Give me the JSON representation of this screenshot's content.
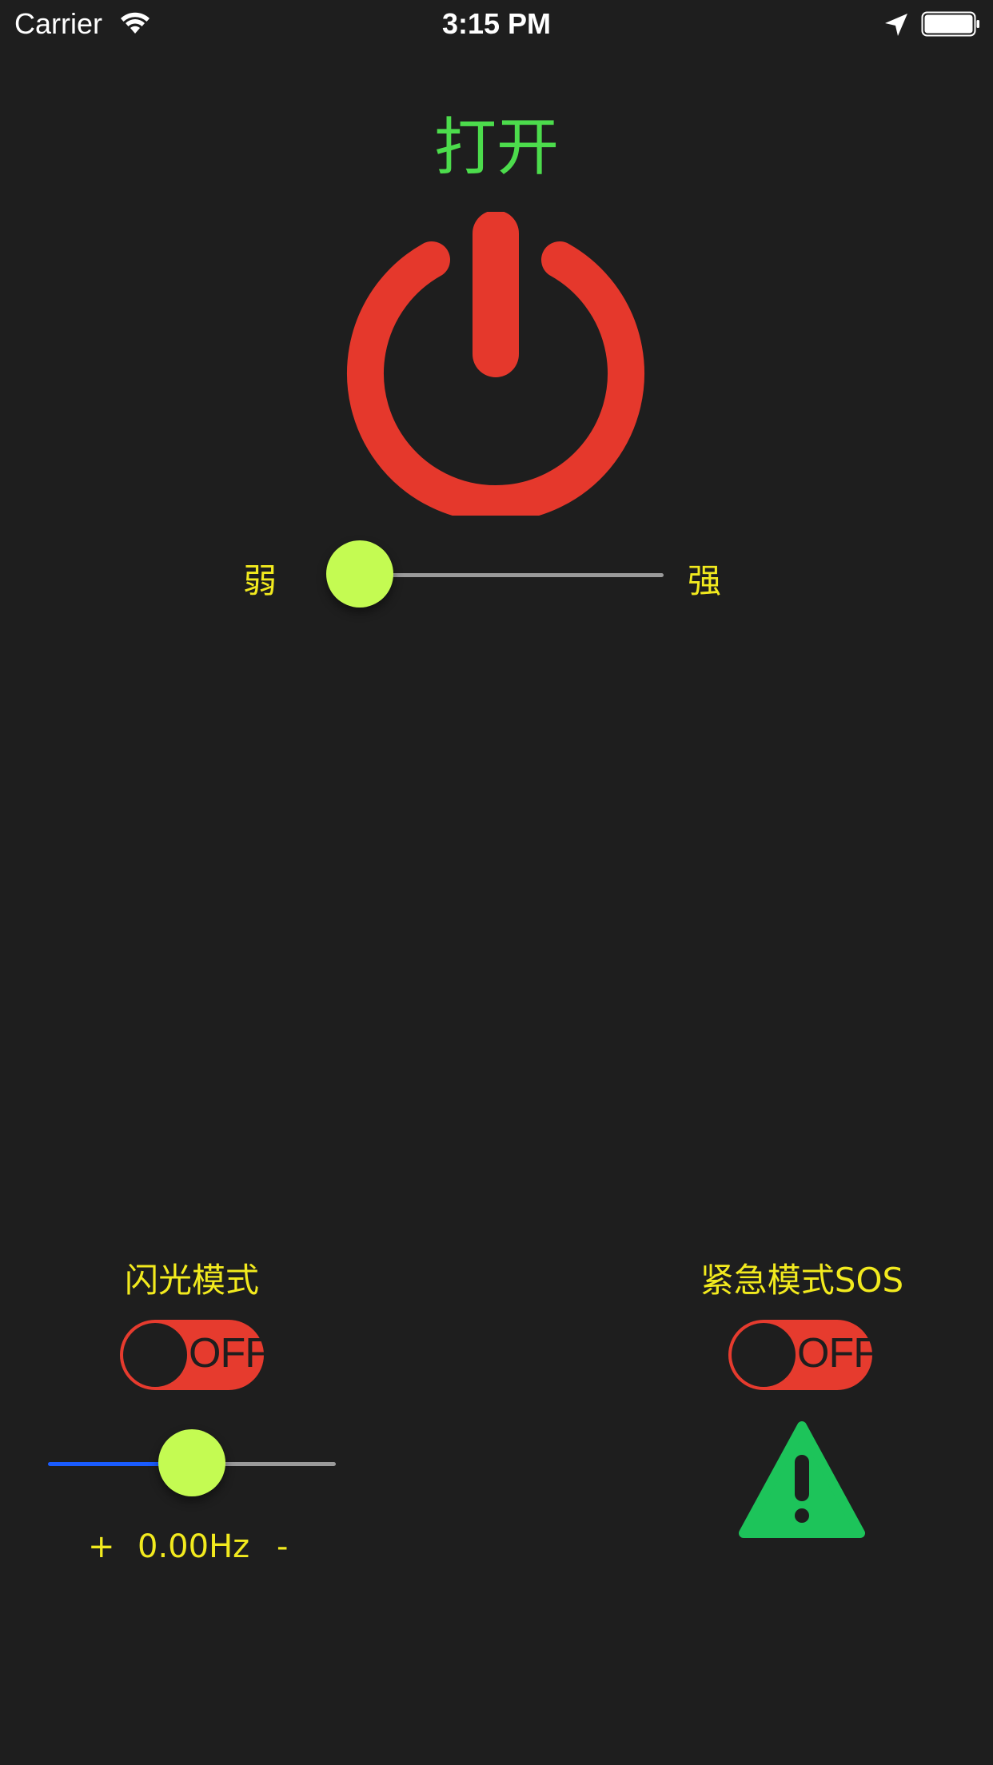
{
  "status_bar": {
    "carrier": "Carrier",
    "time": "3:15 PM",
    "icons": [
      "wifi-icon",
      "location-icon",
      "battery-icon"
    ]
  },
  "power": {
    "title": "打开",
    "icon": "power-icon",
    "title_color": "#4cdc4c",
    "icon_color": "#e5382c"
  },
  "brightness": {
    "low_label": "弱",
    "high_label": "强",
    "level": 0.0
  },
  "flash_mode": {
    "title": "闪光模式",
    "toggle_label": "OFF",
    "toggle_state": "off",
    "frequency_level": 0.5,
    "plus_label": "+",
    "frequency_value": "0.00Hz",
    "minus_label": "-"
  },
  "sos_mode": {
    "title": "紧急模式SOS",
    "toggle_label": "OFF",
    "toggle_state": "off",
    "icon": "warning-icon",
    "icon_color": "#1dc45a"
  },
  "colors": {
    "background": "#1e1e1e",
    "label_yellow": "#f2ea1e",
    "thumb": "#c4fb52",
    "toggle_off": "#e63b2e",
    "slider_fill": "#1a5cff",
    "slider_track": "#9a9a9a"
  }
}
